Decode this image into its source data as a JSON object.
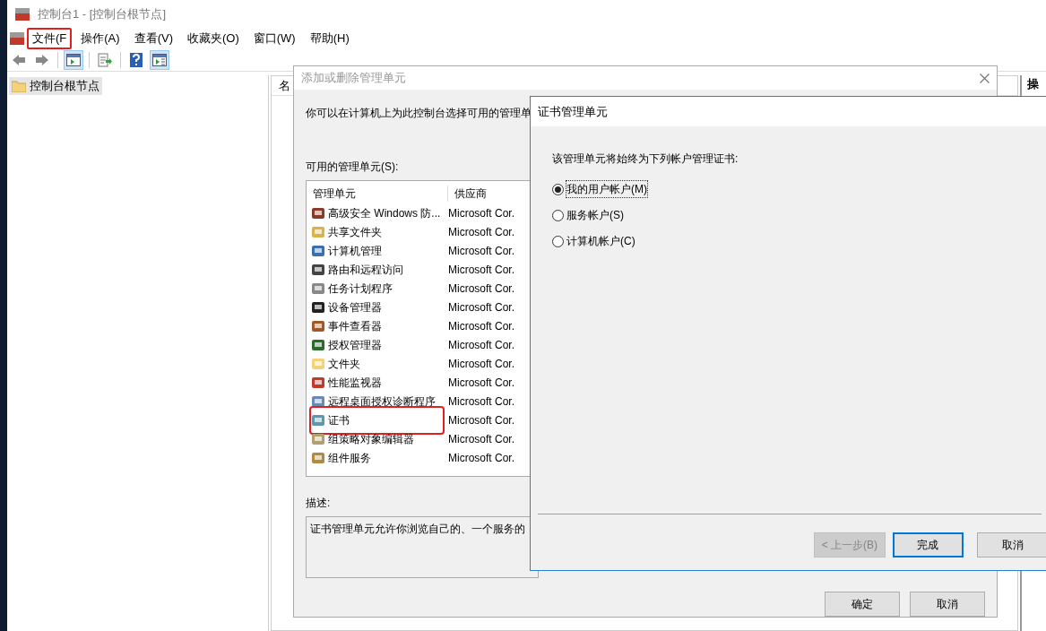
{
  "window": {
    "title": "控制台1 - [控制台根节点]"
  },
  "menu": [
    {
      "label": "文件(F",
      "highlighted": true
    },
    {
      "label": "操作(A)",
      "highlighted": false
    },
    {
      "label": "查看(V)",
      "highlighted": false
    },
    {
      "label": "收藏夹(O)",
      "highlighted": false
    },
    {
      "label": "窗口(W)",
      "highlighted": false
    },
    {
      "label": "帮助(H)",
      "highlighted": false
    }
  ],
  "toolbar": [
    {
      "kind": "back"
    },
    {
      "kind": "forward"
    },
    {
      "kind": "tree",
      "selected": true
    },
    {
      "kind": "export",
      "selected": false
    },
    {
      "kind": "help",
      "selected": false
    },
    {
      "kind": "action",
      "selected": true
    }
  ],
  "tree": {
    "items": [
      {
        "label": "控制台根节点",
        "selected": true
      }
    ]
  },
  "center_panel": {
    "column_1": "名"
  },
  "right_panel": {
    "header": "操"
  },
  "add_remove_dialog": {
    "title": "添加或删除管理单元",
    "intro": "你可以在计算机上为此控制台选择可用的管理单",
    "available_label": "可用的管理单元(S):",
    "columns": [
      "管理单元",
      "供应商"
    ],
    "rows": [
      {
        "name": "高级安全 Windows 防...",
        "vendor": "Microsoft Cor.",
        "highlighted": false
      },
      {
        "name": "共享文件夹",
        "vendor": "Microsoft Cor.",
        "highlighted": false
      },
      {
        "name": "计算机管理",
        "vendor": "Microsoft Cor.",
        "highlighted": false
      },
      {
        "name": "路由和远程访问",
        "vendor": "Microsoft Cor.",
        "highlighted": false
      },
      {
        "name": "任务计划程序",
        "vendor": "Microsoft Cor.",
        "highlighted": false
      },
      {
        "name": "设备管理器",
        "vendor": "Microsoft Cor.",
        "highlighted": false
      },
      {
        "name": "事件查看器",
        "vendor": "Microsoft Cor.",
        "highlighted": false
      },
      {
        "name": "授权管理器",
        "vendor": "Microsoft Cor.",
        "highlighted": false
      },
      {
        "name": "文件夹",
        "vendor": "Microsoft Cor.",
        "highlighted": false
      },
      {
        "name": "性能监视器",
        "vendor": "Microsoft Cor.",
        "highlighted": false
      },
      {
        "name": "远程桌面授权诊断程序",
        "vendor": "Microsoft Cor.",
        "highlighted": false
      },
      {
        "name": "证书",
        "vendor": "Microsoft Cor.",
        "highlighted": true
      },
      {
        "name": "组策略对象编辑器",
        "vendor": "Microsoft Cor.",
        "highlighted": false
      },
      {
        "name": "组件服务",
        "vendor": "Microsoft Cor.",
        "highlighted": false
      }
    ],
    "description_label": "描述:",
    "description": "证书管理单元允许你浏览自己的、一个服务的",
    "buttons": [
      "确定",
      "取消"
    ]
  },
  "cert_dialog": {
    "title": "证书管理单元",
    "prompt": "该管理单元将始终为下列帐户管理证书:",
    "options": [
      {
        "label": "我的用户帐户(M)",
        "selected": true
      },
      {
        "label": "服务帐户(S)",
        "selected": false
      },
      {
        "label": "计算机帐户(C)",
        "selected": false
      }
    ],
    "buttons": [
      {
        "label": "< 上一步(B)",
        "disabled": true,
        "default": false
      },
      {
        "label": "完成",
        "disabled": false,
        "default": true
      },
      {
        "label": "取消",
        "disabled": false,
        "default": false
      }
    ]
  }
}
